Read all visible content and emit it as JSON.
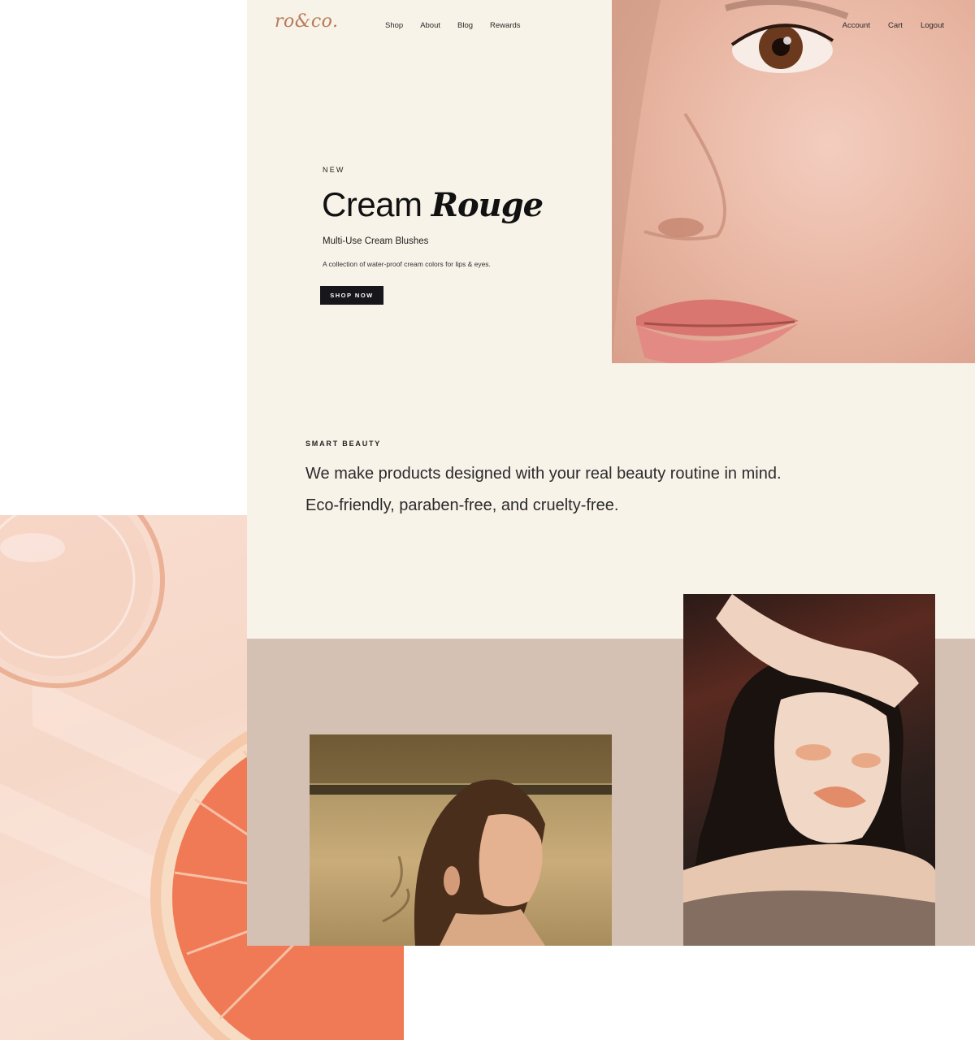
{
  "brand": {
    "logo": "ro&co."
  },
  "nav": {
    "left": [
      "Shop",
      "About",
      "Blog",
      "Rewards"
    ],
    "right": [
      "Account",
      "Cart",
      "Logout"
    ]
  },
  "hero": {
    "eyebrow": "NEW",
    "title_plain": "Cream",
    "title_italic": "Rouge",
    "subtitle": "Multi-Use Cream Blushes",
    "description": "A collection of water-proof cream colors for lips & eyes.",
    "cta": "SHOP NOW"
  },
  "smart_beauty": {
    "label": "SMART BEAUTY",
    "line1": "We make products designed with your real beauty routine in mind.",
    "line2": "Eco-friendly, paraben-free, and cruelty-free."
  },
  "colors": {
    "cream": "#f8f3e9",
    "taupe": "#d5c1b4",
    "logo": "#b77a56",
    "button": "#16161b"
  }
}
